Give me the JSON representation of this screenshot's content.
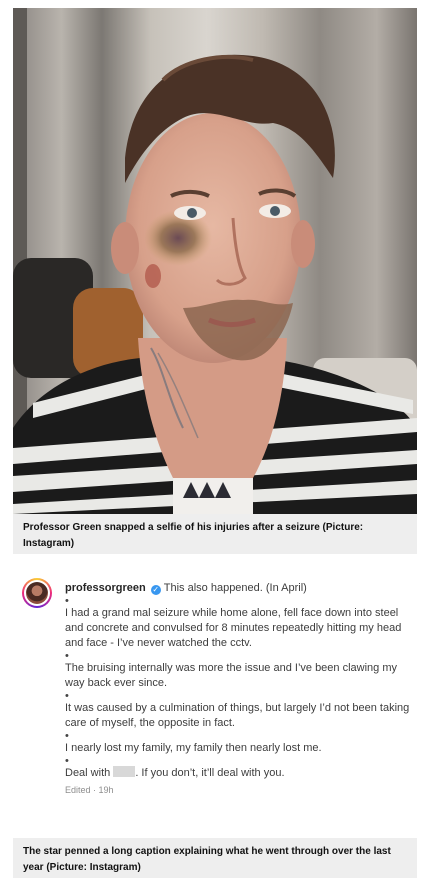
{
  "figure1": {
    "caption": "Professor Green snapped a selfie of his injuries after a seizure (Picture: Instagram)"
  },
  "post": {
    "username": "professorgreen",
    "intro": "This also happened. (In April)",
    "bullet": "•",
    "paragraphs": [
      "I had a grand mal seizure while home alone, fell face down into steel and concrete and convulsed for 8 minutes repeatedly hitting my head and face - I’ve never watched the cctv.",
      "The bruising internally was more the issue and I’ve been clawing my way back ever since.",
      "It was caused by a culmination of things, but largely I’d not been taking care of myself, the opposite in fact.",
      "I nearly lost my family, my family then nearly lost me."
    ],
    "last_before": "Deal with",
    "last_after": ". If you don’t, it’ll deal with you.",
    "edited": "Edited · 19h",
    "verified_color": "#3897f0"
  },
  "figure2": {
    "caption": "The star penned a long caption explaining what he went through over the last year (Picture: Instagram)"
  }
}
